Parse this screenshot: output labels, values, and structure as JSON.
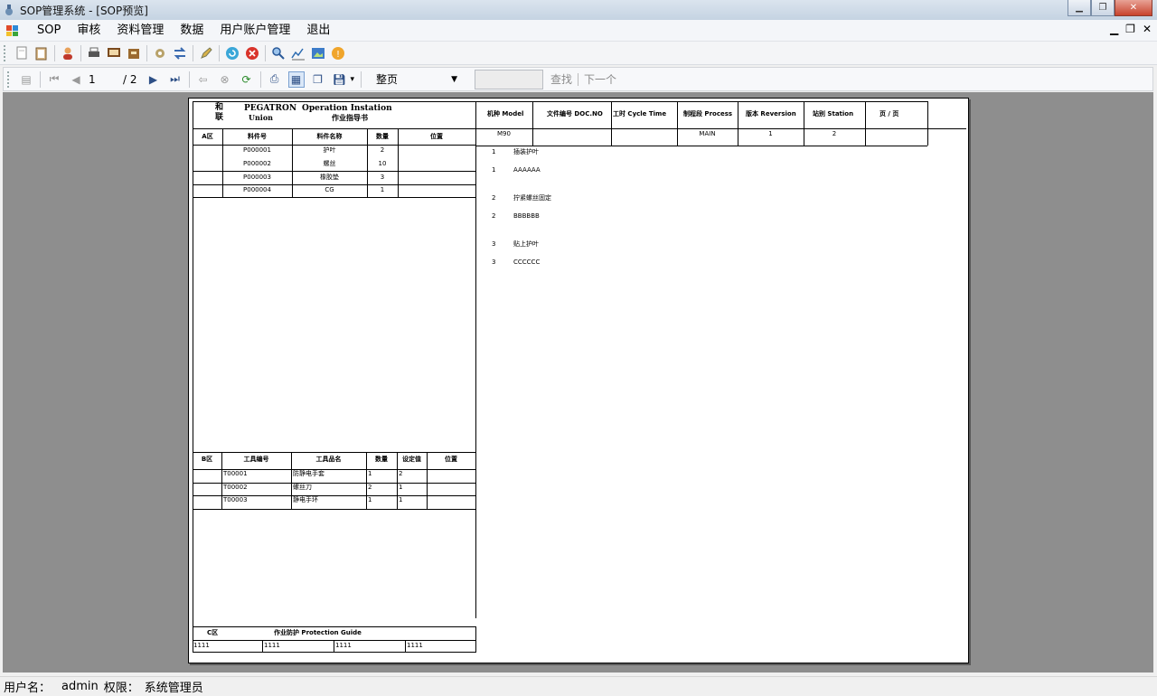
{
  "window": {
    "title": "SOP管理系统 - [SOP预览]"
  },
  "menu": {
    "items": [
      "SOP",
      "审核",
      "资料管理",
      "数据",
      "用户账户管理",
      "退出"
    ]
  },
  "viewer_toolbar": {
    "page": "1",
    "page_total": "/ 2",
    "zoom": "整页",
    "find": "查找",
    "next": "下一个"
  },
  "doc": {
    "header": {
      "company_cn": "和\n硕",
      "company_cn2": "联\n硕",
      "pegatron": "PEGATRON",
      "union": "Union",
      "title_en": "Operation Instation",
      "title_cn": "作业指导书",
      "cols": [
        "机种 Model",
        "文件编号 DOC.NO",
        "工时 Cycle Time",
        "制程段 Process",
        "版本 Reversion",
        "站别 Station",
        "页 / 页"
      ],
      "vals": [
        "M90",
        "",
        "",
        "MAIN",
        "1",
        "2",
        ""
      ]
    },
    "parts": {
      "headers": [
        "A区",
        "料件号",
        "料件名称",
        "数量",
        "位置"
      ],
      "rows": [
        [
          "",
          "P000001",
          "护叶",
          "2",
          ""
        ],
        [
          "",
          "P000002",
          "螺丝",
          "10",
          ""
        ],
        [
          "",
          "P000003",
          "橡胶垫",
          "3",
          ""
        ],
        [
          "",
          "P000004",
          "CG",
          "1",
          ""
        ]
      ]
    },
    "tools": {
      "headers": [
        "B区",
        "工具编号",
        "工具品名",
        "数量",
        "设定值",
        "位置"
      ],
      "rows": [
        [
          "",
          "T00001",
          "防静电手套",
          "1",
          "2",
          ""
        ],
        [
          "",
          "T00002",
          "螺丝刀",
          "2",
          "1",
          ""
        ],
        [
          "",
          "T00003",
          "静电手环",
          "1",
          "1",
          ""
        ]
      ]
    },
    "protection": {
      "zone": "C区",
      "title": "作业防护  Protection Guide",
      "cells": [
        "1111",
        "1111",
        "1111",
        "1111"
      ]
    },
    "steps": [
      {
        "no": "1",
        "text": "插装护叶"
      },
      {
        "no": "1",
        "text": "AAAAAA"
      },
      {
        "no": "2",
        "text": "拧紧螺丝固定"
      },
      {
        "no": "2",
        "text": "BBBBBB"
      },
      {
        "no": "3",
        "text": "贴上护叶"
      },
      {
        "no": "3",
        "text": "CCCCCC"
      }
    ]
  },
  "status": {
    "user_label": "用户名：",
    "user": "admin",
    "role_label": "权限：",
    "role": "系统管理员"
  }
}
